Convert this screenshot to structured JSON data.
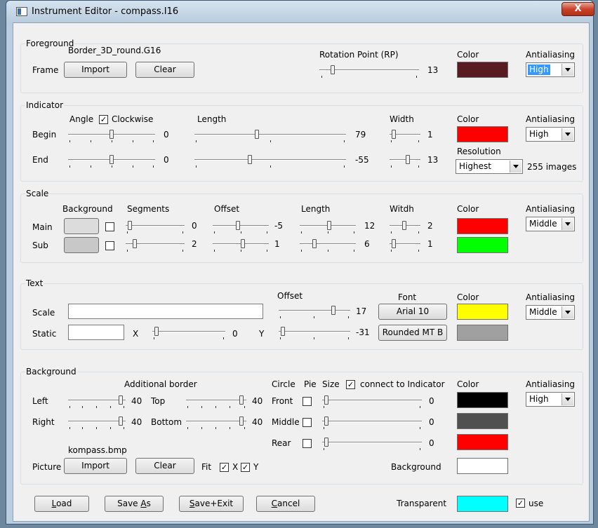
{
  "window": {
    "title": "Instrument Editor - compass.I16",
    "close_glyph": "X"
  },
  "foreground": {
    "legend": "Foreground",
    "frame_label": "Frame",
    "frame_file": "Border_3D_round.G16",
    "import_label": "Import",
    "clear_label": "Clear",
    "rotation_label": "Rotation Point (RP)",
    "rotation_value": "13",
    "color_label": "Color",
    "color": "#5a1a22",
    "antialias_label": "Antialiasing",
    "antialias_value": "High"
  },
  "indicator": {
    "legend": "Indicator",
    "angle_label": "Angle",
    "clockwise_label": "Clockwise",
    "clockwise_checked": true,
    "length_label": "Length",
    "width_label": "Width",
    "begin_label": "Begin",
    "end_label": "End",
    "begin_angle": "0",
    "end_angle": "0",
    "begin_length": "79",
    "end_length": "-55",
    "begin_width": "1",
    "end_width": "13",
    "color_label": "Color",
    "color": "#ff0000",
    "antialias_label": "Antialiasing",
    "antialias_value": "High",
    "resolution_label": "Resolution",
    "resolution_value": "Highest",
    "images_label": "255 images"
  },
  "scale": {
    "legend": "Scale",
    "background_label": "Background",
    "segments_label": "Segments",
    "offset_label": "Offset",
    "length_label": "Length",
    "width_label": "Witdh",
    "main_label": "Main",
    "sub_label": "Sub",
    "main_segments": "0",
    "main_offset": "-5",
    "main_length": "12",
    "main_width": "2",
    "sub_segments": "2",
    "sub_offset": "1",
    "sub_length": "6",
    "sub_width": "1",
    "color_label": "Color",
    "main_color": "#ff0000",
    "sub_color": "#00ff00",
    "antialias_label": "Antialiasing",
    "antialias_value": "Middle"
  },
  "text": {
    "legend": "Text",
    "scale_label": "Scale",
    "static_label": "Static",
    "offset_label": "Offset",
    "offset_value": "17",
    "x_label": "X",
    "x_value": "0",
    "y_label": "Y",
    "y_value": "-31",
    "font_label": "Font",
    "font_scale": "Arial 10",
    "font_static": "Rounded MT B",
    "color_label": "Color",
    "scale_color": "#ffff00",
    "static_color": "#a0a0a0",
    "antialias_label": "Antialiasing",
    "antialias_value": "Middle"
  },
  "background": {
    "legend": "Background",
    "additional_border_label": "Additional border",
    "left_label": "Left",
    "right_label": "Right",
    "top_label": "Top",
    "bottom_label": "Bottom",
    "left_value": "40",
    "right_value": "40",
    "top_value": "40",
    "bottom_value": "40",
    "circle_label": "Circle",
    "pie_label": "Pie",
    "size_label": "Size",
    "connect_label": "connect to Indicator",
    "connect_checked": true,
    "front_label": "Front",
    "middle_label": "Middle",
    "rear_label": "Rear",
    "front_value": "0",
    "middle_value": "0",
    "rear_value": "0",
    "color_label": "Color",
    "front_color": "#000000",
    "middle_color": "#505050",
    "rear_color": "#ff0000",
    "background_label": "Background",
    "background_color": "#ffffff",
    "antialias_label": "Antialiasing",
    "antialias_value": "High",
    "picture_label": "Picture",
    "picture_file": "kompass.bmp",
    "import_label": "Import",
    "clear_label": "Clear",
    "fit_label": "Fit",
    "fit_x_label": "X",
    "fit_y_label": "Y",
    "fit_x_checked": true,
    "fit_y_checked": true
  },
  "footer": {
    "load_key": "L",
    "load_rest": "oad",
    "saveas_pre": "Save ",
    "saveas_key": "A",
    "saveas_rest": "s",
    "saveexit_key": "S",
    "saveexit_rest": "ave+Exit",
    "cancel_key": "C",
    "cancel_rest": "ancel",
    "transparent_label": "Transparent",
    "transparent_color": "#00ffff",
    "use_label": "use",
    "use_checked": true
  }
}
